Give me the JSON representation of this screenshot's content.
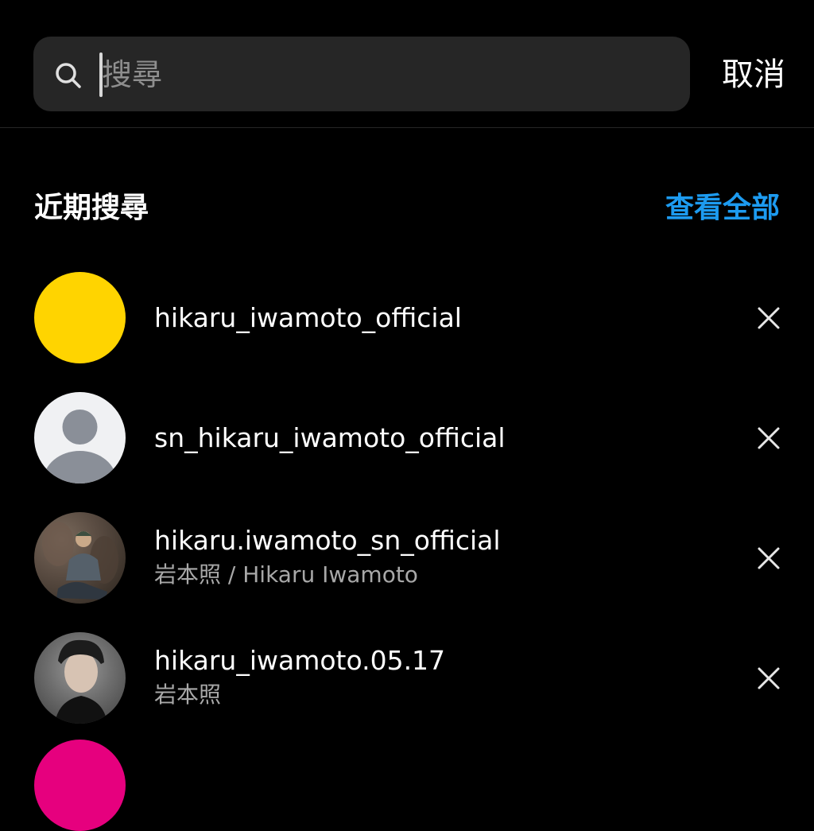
{
  "search": {
    "placeholder": "搜尋",
    "value": "",
    "cancel_label": "取消"
  },
  "recent": {
    "title": "近期搜尋",
    "see_all_label": "查看全部",
    "accent_color": "#1d9bf0"
  },
  "results": [
    {
      "username": "hikaru_iwamoto_official",
      "subtitle": "",
      "avatar": "yellow-circle"
    },
    {
      "username": "sn_hikaru_iwamoto_official",
      "subtitle": "",
      "avatar": "default-person-icon"
    },
    {
      "username": "hikaru.iwamoto_sn_official",
      "subtitle": "岩本照 / Hikaru Iwamoto",
      "avatar": "photo-sitting-outdoors"
    },
    {
      "username": "hikaru_iwamoto.05.17",
      "subtitle": "岩本照",
      "avatar": "photo-portrait"
    }
  ],
  "icons": {
    "search": "search-icon",
    "remove": "close-icon"
  }
}
